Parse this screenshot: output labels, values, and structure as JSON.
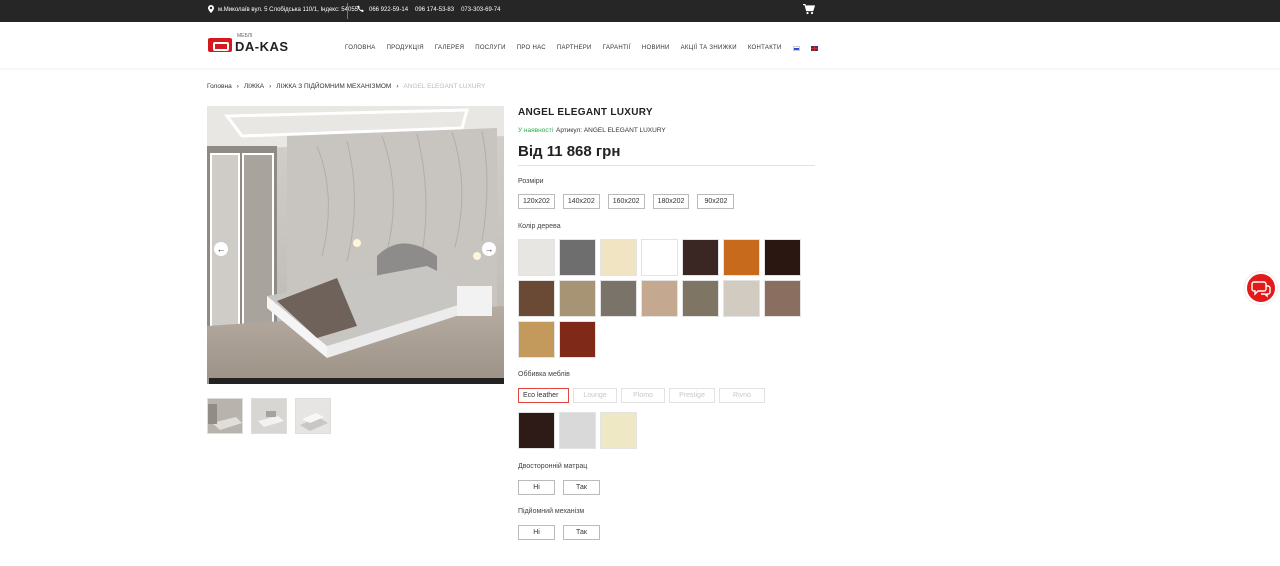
{
  "topbar": {
    "address": "м.Миколаїв вул. 5 Слобідська 110/1, Індекс: 54055",
    "phones": [
      "066 922-59-14",
      "096 174-53-83",
      "073-303-69-74"
    ]
  },
  "header": {
    "logo_text": "DA-KAS",
    "logo_sub": "МЕБЛІ",
    "nav": [
      "ГОЛОВНА",
      "ПРОДУКЦІЯ",
      "ГАЛЕРЕЯ",
      "ПОСЛУГИ",
      "ПРО НАС",
      "ПАРТНЕРИ",
      "ГАРАНТІЇ",
      "НОВИНИ",
      "АКЦІЇ ТА ЗНИЖКИ",
      "КОНТАКТИ"
    ]
  },
  "breadcrumbs": [
    "Головна",
    "ЛІЖКА",
    "ЛІЖКА З ПІДЙОМНИМ МЕХАНІЗМОМ",
    "ANGEL ELEGANT LUXURY"
  ],
  "product": {
    "title": "ANGEL ELEGANT LUXURY",
    "stock": "У наявності",
    "sku": "Артикул: ANGEL ELEGANT LUXURY",
    "price": "Від 11 868 грн"
  },
  "sizes": {
    "label": "Розміри",
    "options": [
      "120x202",
      "140x202",
      "160x202",
      "180x202",
      "90x202"
    ]
  },
  "wood": {
    "label": "Колір дерева",
    "colors": [
      "#e8e6e3",
      "#6e6e6e",
      "#f0e4c2",
      "#ffffff",
      "#3a2622",
      "#c86a1c",
      "#2b1712",
      "#6a4a35",
      "#a69475",
      "#7a736a",
      "#c4a990",
      "#7f7565",
      "#d2cbc2",
      "#8a6e60",
      "#c39a5c",
      "#7f2a18"
    ]
  },
  "upholstery": {
    "label": "Оббивка меблів",
    "options": [
      "Eco leather",
      "Lounge",
      "Plomo",
      "Prestige",
      "Rivno"
    ],
    "colors": [
      "#2e1a17",
      "#d9d9d9",
      "#efe8c4"
    ]
  },
  "mattress": {
    "label": "Двосторонній матрац",
    "options": [
      "Ні",
      "Так"
    ]
  },
  "mechanism": {
    "label": "Підйомний механізм",
    "options": [
      "Ні",
      "Так"
    ]
  }
}
